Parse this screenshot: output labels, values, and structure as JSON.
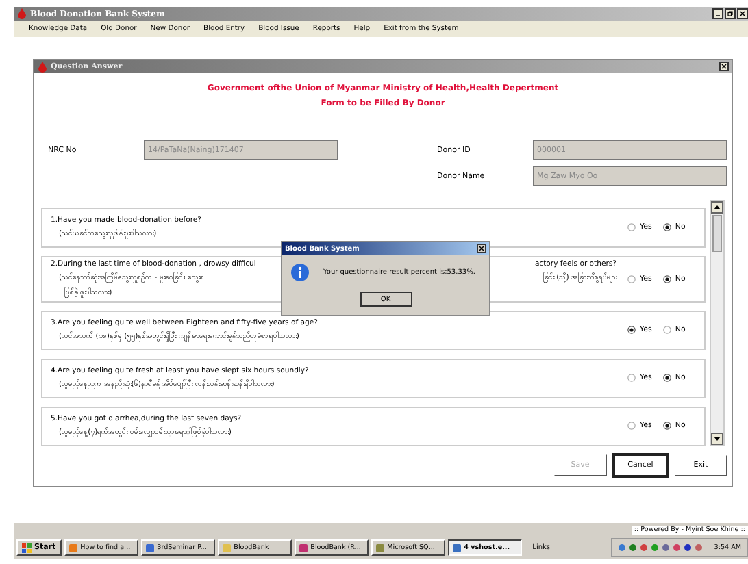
{
  "app_window": {
    "title": "Blood Donation Bank System"
  },
  "menu": [
    "Knowledge Data",
    "Old Donor",
    "New Donor",
    "Blood Entry",
    "Blood Issue",
    "Reports",
    "Help",
    "Exit from the System"
  ],
  "dialog": {
    "title": "Question Answer",
    "heading": [
      "Government ofthe Union of Myanmar Ministry of Health,Health Depertment",
      "Form to be Filled By Donor"
    ],
    "fields": [
      {
        "label": "NRC No",
        "value": "14/PaTaNa(Naing)171407"
      },
      {
        "label": "Donor ID",
        "value": "000001"
      },
      {
        "label": "Donor Name",
        "value": "Mg Zaw Myo Oo"
      }
    ],
    "questions": [
      {
        "lines": [
          [
            "1.Have you made blood-donation before?"
          ],
          [
            "(သင်ယခင်ကသွေးလှူဒါန်းဖူးပါသလား)"
          ]
        ],
        "options": [
          {
            "label": "Yes",
            "selected": false
          },
          {
            "label": "No",
            "selected": true
          }
        ]
      },
      {
        "lines": [
          [
            "2.During the last time of blood-donation , drowsy difficul",
            "actory feels or others?"
          ],
          [
            "(သင်နောက်ဆုံးအကြိမ်သွေးလှူစဉ်က - မူးဝေခြင်း၊ သွေးစ",
            "ခြင်း (သို့) အခြားကိစ္စရပ်များ"
          ],
          [
            "ဖြစ်ခဲ့ ဖူးပါသလား)"
          ]
        ],
        "options": [
          {
            "label": "Yes",
            "selected": false
          },
          {
            "label": "No",
            "selected": true
          }
        ]
      },
      {
        "lines": [
          [
            "3.Are you feeling quite well between Eighteen and fifty-five years of age?"
          ],
          [
            "(သင်အသက် (၁၈)နှစ်မှ (၅၅)နှစ်အတွင်းရှိပြီး ကျန်းမာရေးကောင်းမွန်သည်ဟုခံစားရပါသလား)"
          ]
        ],
        "options": [
          {
            "label": "Yes",
            "selected": true
          },
          {
            "label": "No",
            "selected": false
          }
        ]
      },
      {
        "lines": [
          [
            "4.Are you feeling quite fresh at least you have slept six hours soundly?"
          ],
          [
            "(လှူမည့်နေ့ညက အနည်းဆုံး(၆)နာရီခန့် အိပ်ပျော်ပြီး လန်းလန်းဆန်းဆန်းရှိပါသလား)"
          ]
        ],
        "options": [
          {
            "label": "Yes",
            "selected": false
          },
          {
            "label": "No",
            "selected": true
          }
        ]
      },
      {
        "lines": [
          [
            "5.Have you got diarrhea,during the last seven days?"
          ],
          [
            "(လှူမည့်နေ့(၇)ရက်အတွင်း ဝမ်းလျှောဝမ်းသွားရောဂါဖြစ်ခဲ့ပါသလား)"
          ]
        ],
        "options": [
          {
            "label": "Yes",
            "selected": false
          },
          {
            "label": "No",
            "selected": true
          }
        ]
      }
    ],
    "buttons": [
      {
        "label": "Save",
        "disabled": true,
        "focused": false
      },
      {
        "label": "Cancel",
        "disabled": false,
        "focused": true
      },
      {
        "label": "Exit",
        "disabled": false,
        "focused": false
      }
    ]
  },
  "message_box": {
    "title": "Blood Bank System",
    "message": "Your questionnaire result percent is:53.33%.",
    "button": "OK"
  },
  "taskbar": {
    "powered_by": ":: Powered By - Myint Soe Khine ::",
    "start": "Start",
    "tasks": [
      {
        "label": "How to find a...",
        "selected": false
      },
      {
        "label": "3rdSeminar P...",
        "selected": false
      },
      {
        "label": "BloodBank",
        "selected": false
      },
      {
        "label": "BloodBank (R...",
        "selected": false
      },
      {
        "label": "Microsoft SQ...",
        "selected": false
      },
      {
        "label": "4 vshost.e...",
        "selected": true
      }
    ],
    "links": "Links",
    "clock": "3:54 AM"
  }
}
